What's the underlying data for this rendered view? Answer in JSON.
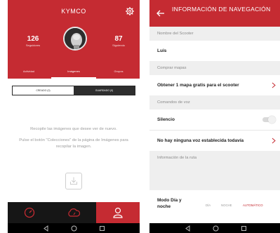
{
  "left": {
    "title": "KYMCO",
    "stats": [
      {
        "value": "126",
        "label": "Seguidores"
      },
      {
        "value": "87",
        "label": "Siguiendo"
      }
    ],
    "tabs": [
      "Actividad",
      "Imágenes",
      "Grupos"
    ],
    "active_tab": 1,
    "segments": [
      "CREADO (0)",
      "GUARDADO (0)"
    ],
    "empty_line1": "Recopile las imágenes que desee ver de nuevo.",
    "empty_line2": "Pulse el botón \"Colecciones\" de la página de Imágenes para recopilar la imagen.",
    "colors": {
      "accent": "#c52b32",
      "dark": "#161616"
    }
  },
  "right": {
    "title": "INFORMACIÓN DE NAVEGACIÓN",
    "sections": {
      "scooter": "Nombre del Scooter",
      "maps": "Comprar mapas",
      "voice": "Comandos de voz",
      "route": "Información de la ruta"
    },
    "scooter_name": "Luis",
    "maps_offer": "Obtener 1 mapa gratis para el scooter",
    "silence_label": "Silencio",
    "silence_on": false,
    "voice_status": "No hay ninguna voz establecida todavía",
    "day_night_label": "Modo Día y noche",
    "day_night_options": [
      "DÍA",
      "NOCHE",
      "AUTOMÁTICO"
    ],
    "day_night_selected": 2
  }
}
